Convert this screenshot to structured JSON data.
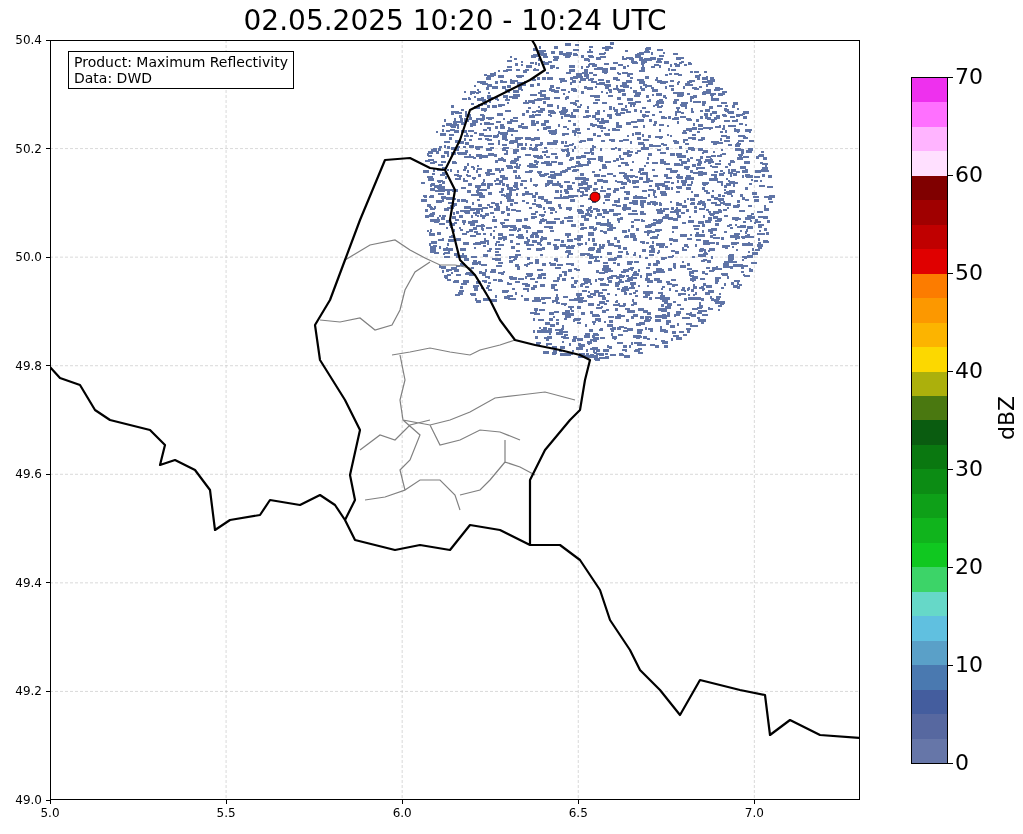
{
  "title": "02.05.2025 10:20 - 10:24 UTC",
  "info_box": [
    "Product: Maximum Reflectivity",
    "Data: DWD"
  ],
  "map": {
    "y_ticks": [
      "50.4",
      "50.2",
      "50.0",
      "49.8",
      "49.6",
      "49.4",
      "49.2",
      "49.0"
    ],
    "x_ticks": [
      "5.0",
      "5.5",
      "6.0",
      "6.5",
      "7.0"
    ]
  },
  "colorbar": {
    "label": "dBZ",
    "ticks": [
      "70",
      "60",
      "50",
      "40",
      "30",
      "20",
      "10",
      "0"
    ],
    "bands": [
      {
        "color": "#6676a8"
      },
      {
        "color": "#5768a0"
      },
      {
        "color": "#445d9e"
      },
      {
        "color": "#4a79b0"
      },
      {
        "color": "#5aa0c8"
      },
      {
        "color": "#60c0e0"
      },
      {
        "color": "#66d8c8"
      },
      {
        "color": "#3cd468"
      },
      {
        "color": "#10c820"
      },
      {
        "color": "#10b41c"
      },
      {
        "color": "#0ea018"
      },
      {
        "color": "#0c8c14"
      },
      {
        "color": "#0a7810"
      },
      {
        "color": "#0a5c10"
      },
      {
        "color": "#4a7810"
      },
      {
        "color": "#acb00c"
      },
      {
        "color": "#fcd800"
      },
      {
        "color": "#fcb400"
      },
      {
        "color": "#fc9800"
      },
      {
        "color": "#fc7c00"
      },
      {
        "color": "#e00000"
      },
      {
        "color": "#c00000"
      },
      {
        "color": "#a00000"
      },
      {
        "color": "#800000"
      },
      {
        "color": "#ffe0ff"
      },
      {
        "color": "#ffb4ff"
      },
      {
        "color": "#ff70ff"
      },
      {
        "color": "#ee30ee"
      }
    ]
  }
}
